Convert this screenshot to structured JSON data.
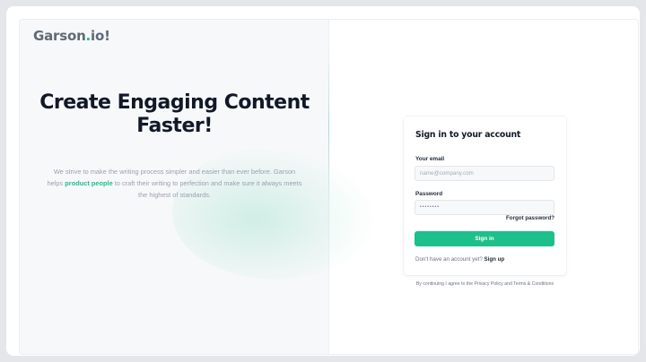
{
  "brand": {
    "name_prefix": "Garson",
    "name_dot": ".",
    "name_suffix": "io!",
    "accent_color": "#1dbf8a"
  },
  "hero": {
    "headline": "Create Engaging Content Faster!",
    "tagline_before": "We strive to make the writing process simpler and easier than ever before. Garson helps ",
    "tagline_highlight": "product people",
    "tagline_after": " to craft their writing to perfection and make sure it always meets the highest of standards."
  },
  "signin": {
    "title": "Sign in to your account",
    "email_label": "Your email",
    "email_placeholder": "name@company.com",
    "password_label": "Password",
    "password_value": "••••••••",
    "forgot_link": "Forgot password?",
    "submit_label": "Sign in",
    "no_account_text": "Don't have an account yet?",
    "signup_link": "Sign up"
  },
  "footer": {
    "terms_text": "By continuing I agree to the Privacy Policy and Terms & Conditions"
  }
}
